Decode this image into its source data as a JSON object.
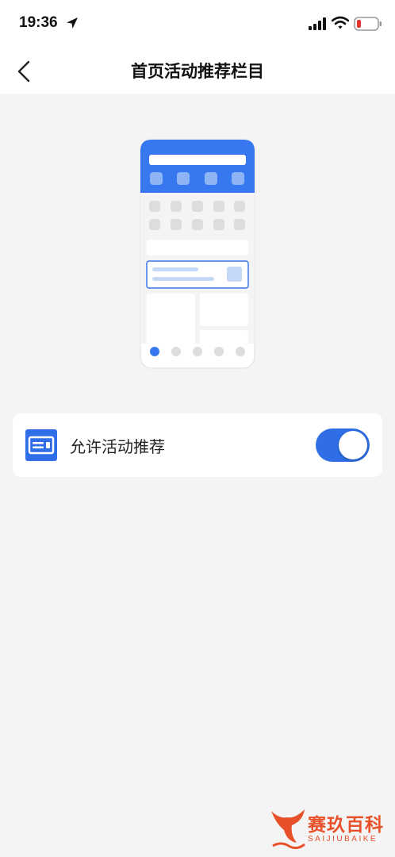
{
  "status_bar": {
    "time": "19:36",
    "icons": [
      "location-arrow-icon",
      "cellular-signal-icon",
      "wifi-icon",
      "battery-low-icon"
    ]
  },
  "nav": {
    "title": "首页活动推荐栏目",
    "back_icon": "chevron-left-icon"
  },
  "illustration": {
    "description_icon": "phone-homepage-illustration",
    "accent": "#3777f0"
  },
  "setting": {
    "icon": "card-icon",
    "label": "允许活动推荐",
    "enabled": true
  },
  "watermark": {
    "text": "赛玖百科",
    "sub": "SAIJIUBAIKE"
  },
  "colors": {
    "accent": "#2f6ee6",
    "background": "#f4f4f4",
    "watermark": "#e8502a"
  }
}
